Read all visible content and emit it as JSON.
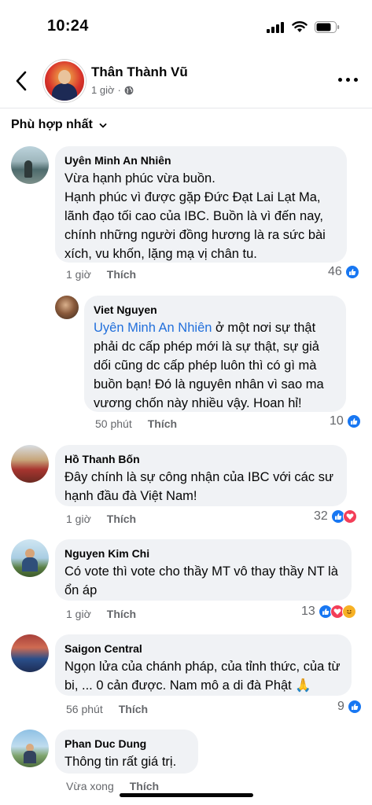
{
  "status_bar": {
    "time": "10:24"
  },
  "post": {
    "author": "Thân Thành Vũ",
    "time": "1 giờ",
    "privacy_icon": "globe-icon"
  },
  "sort": {
    "label": "Phù hợp nhất"
  },
  "comments": [
    {
      "name": "Uyên Minh An Nhiên",
      "text": "Vừa hạnh phúc vừa buồn.\nHạnh phúc vì được gặp Đức Đạt Lai Lạt Ma, lãnh đạo tối cao của IBC. Buồn là vì đến nay, chính những người đồng hương là ra sức bài xích, vu khốn, lặng mạ vị chân tu.",
      "time": "1 giờ",
      "like_label": "Thích",
      "reaction_count": "46"
    },
    {
      "name": "Viet Nguyen",
      "mention": "Uyên Minh An Nhiên",
      "text": " ở một nơi sự thật phải dc cấp phép mới là sự thật, sự giả dối cũng dc cấp phép luôn thì có gì mà buồn bạn! Đó là nguyên nhân vì sao ma vương chốn này nhiều vậy. Hoan hỉ!",
      "time": "50 phút",
      "like_label": "Thích",
      "reaction_count": "10"
    },
    {
      "name": "Hồ Thanh Bốn",
      "text": "Đây chính là sự công nhận của IBC với các sư hạnh đầu đà Việt Nam!",
      "time": "1 giờ",
      "like_label": "Thích",
      "reaction_count": "32"
    },
    {
      "name": "Nguyen Kim Chi",
      "text": "Có vote thì vote cho thầy MT vô thay thầy NT là ổn áp",
      "time": "1 giờ",
      "like_label": "Thích",
      "reaction_count": "13"
    },
    {
      "name": "Saigon Central",
      "text": "Ngọn lửa của chánh pháp, của tỉnh thức, của từ bi, ... 0 cản được. Nam mô a di đà Phật 🙏",
      "time": "56 phút",
      "like_label": "Thích",
      "reaction_count": "9"
    },
    {
      "name": "Phan Duc Dung",
      "text": "Thông tin rất giá trị.",
      "time": "Vừa xong",
      "like_label": "Thích"
    }
  ],
  "colors": {
    "accent": "#1877f2",
    "bubble": "#f0f2f5",
    "meta": "#65676b",
    "mention": "#216fdb"
  }
}
